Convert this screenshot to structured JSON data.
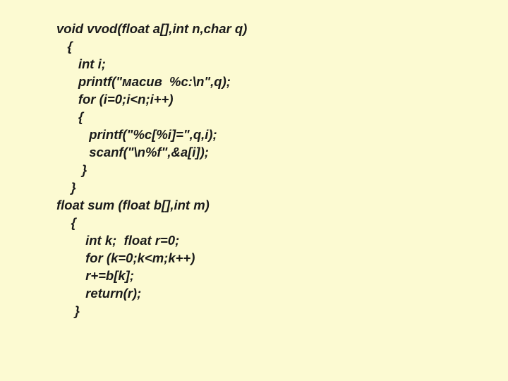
{
  "code": {
    "lines": [
      "void vvod(float a[],int n,char q)",
      "   {",
      "      int i;",
      "      printf(\"масив  %c:\\n\",q);",
      "      for (i=0;i<n;i++)",
      "      {",
      "         printf(\"%c[%i]=\",q,i);",
      "         scanf(\"\\n%f\",&a[i]);",
      "       }",
      "    }",
      "float sum (float b[],int m)",
      "    {",
      "        int k;  float r=0;",
      "        for (k=0;k<m;k++)",
      "        r+=b[k];",
      "        return(r);",
      "     }"
    ]
  }
}
